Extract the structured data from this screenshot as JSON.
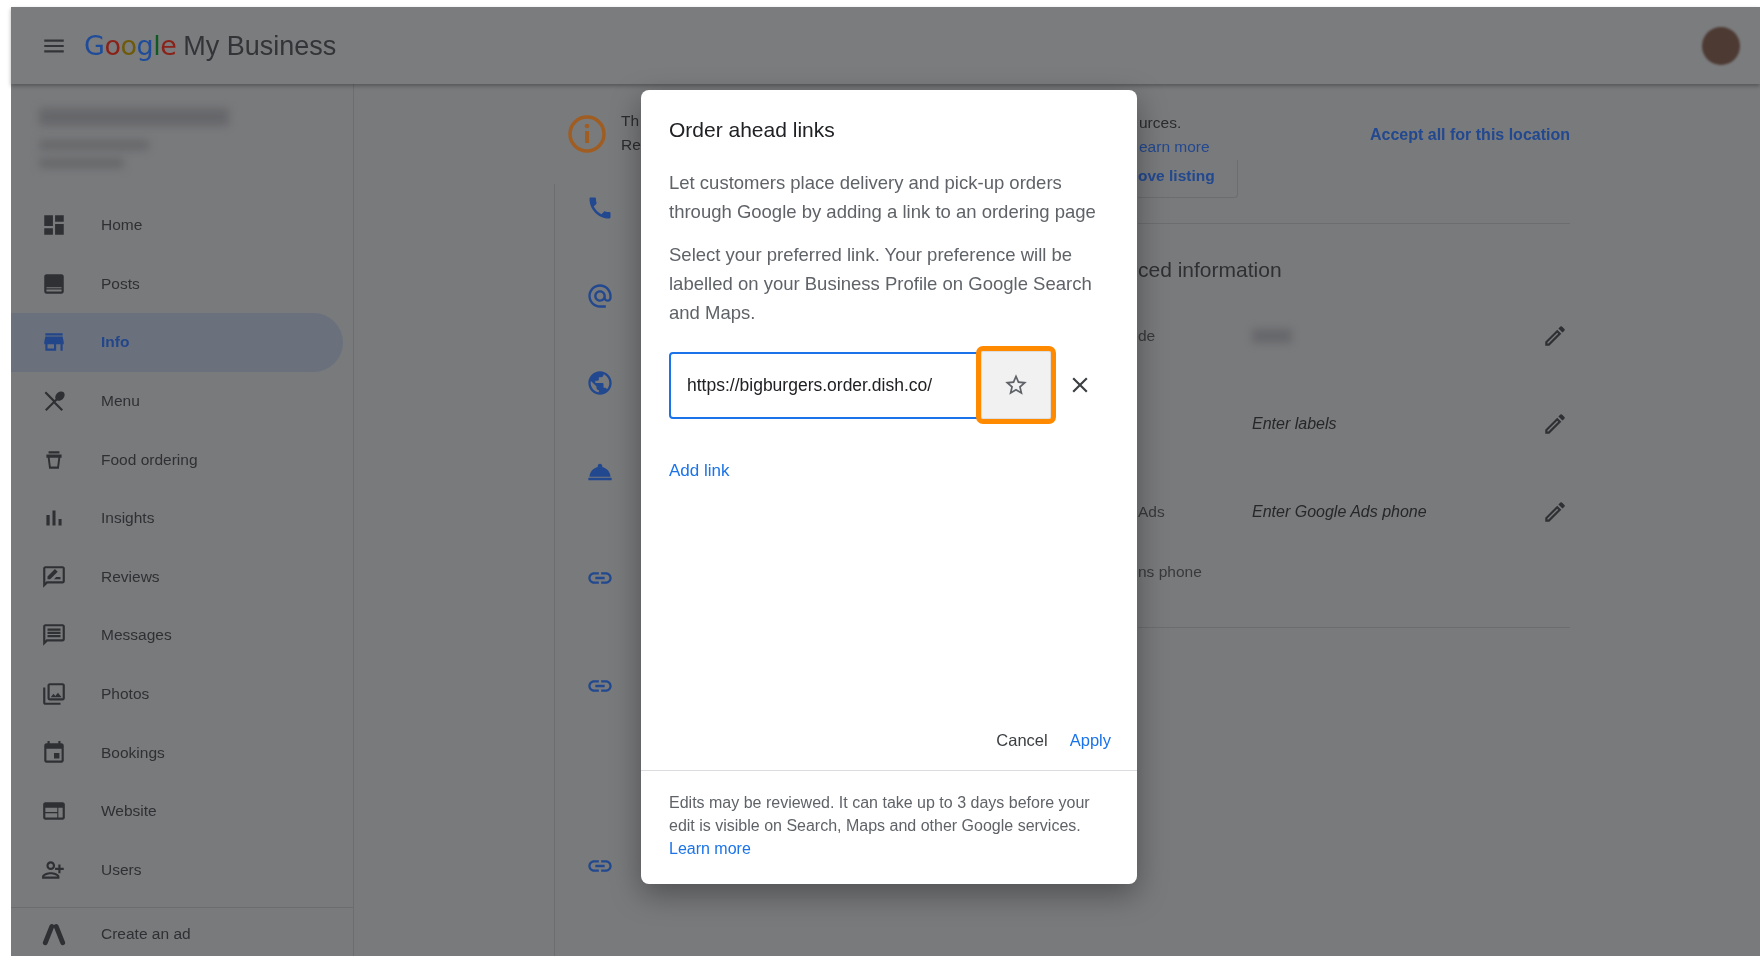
{
  "header": {
    "logo_brand": "Google",
    "logo_product": "My Business"
  },
  "sidebar": {
    "items": [
      {
        "label": "Home",
        "selected": false
      },
      {
        "label": "Posts",
        "selected": false
      },
      {
        "label": "Info",
        "selected": true
      },
      {
        "label": "Menu",
        "selected": false
      },
      {
        "label": "Food ordering",
        "selected": false
      },
      {
        "label": "Insights",
        "selected": false
      },
      {
        "label": "Reviews",
        "selected": false
      },
      {
        "label": "Messages",
        "selected": false
      },
      {
        "label": "Photos",
        "selected": false
      },
      {
        "label": "Bookings",
        "selected": false
      },
      {
        "label": "Website",
        "selected": false
      },
      {
        "label": "Users",
        "selected": false
      }
    ],
    "footer_item": "Create an ad"
  },
  "banner": {
    "lines": [
      "Th",
      "Re"
    ],
    "lines_end": [
      "urces.",
      "earn more"
    ],
    "accept_all": "Accept all for this location",
    "remove_button": "ove listing"
  },
  "advanced": {
    "title": "ced information",
    "rows": [
      {
        "label": "de",
        "kind": "blurred",
        "editable": true
      },
      {
        "kind": "placeholder",
        "placeholder": "Enter labels",
        "editable": true
      },
      {
        "label": "Ads",
        "kind": "placeholder",
        "placeholder": "Enter Google Ads phone",
        "editable": true
      },
      {
        "label": "ns phone",
        "kind": "empty",
        "editable": false
      }
    ]
  },
  "dialog": {
    "title": "Order ahead links",
    "paragraphs": [
      "Let customers place delivery and pick-up orders through Google by adding a link to an ordering page",
      "Select your preferred link. Your preference will be labelled on your Business Profile on Google Search and Maps."
    ],
    "links": [
      {
        "value": "https://bigburgers.order.dish.co/",
        "preferred": false,
        "highlighted": true
      }
    ],
    "add_link": "Add link",
    "actions": [
      {
        "label": "Cancel",
        "kind": "secondary"
      },
      {
        "label": "Apply",
        "kind": "primary"
      }
    ],
    "footer_text": "Edits may be reviewed. It can take up to 3 days before your edit is visible on Search, Maps and other Google services.",
    "footer_link": "Learn more"
  }
}
